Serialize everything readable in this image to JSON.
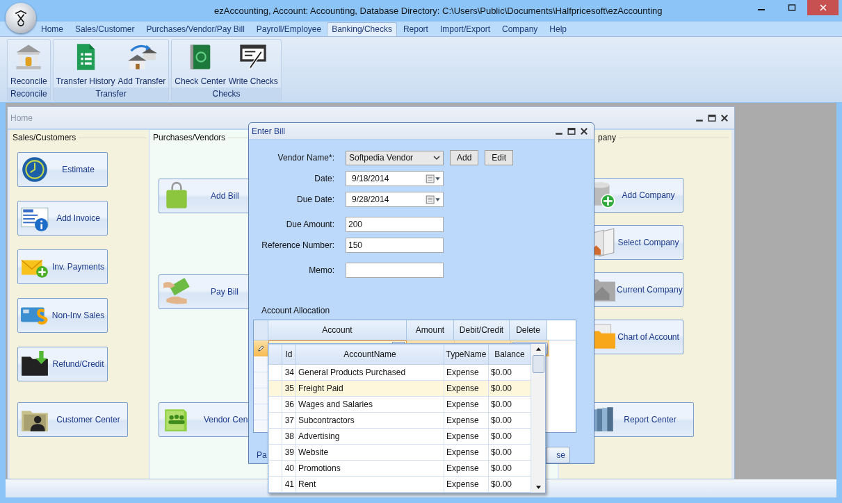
{
  "window": {
    "title": "ezAccounting, Account: Accounting, Database Directory: C:\\Users\\Public\\Documents\\Halfpricesoft\\ezAccounting"
  },
  "menu_tabs": [
    {
      "label": "Home",
      "selected": false
    },
    {
      "label": "Sales/Customer",
      "selected": false
    },
    {
      "label": "Purchases/Vendor/Pay Bill",
      "selected": false
    },
    {
      "label": "Payroll/Employee",
      "selected": false
    },
    {
      "label": "Banking/Checks",
      "selected": true
    },
    {
      "label": "Report",
      "selected": false
    },
    {
      "label": "Import/Export",
      "selected": false
    },
    {
      "label": "Company",
      "selected": false
    },
    {
      "label": "Help",
      "selected": false
    }
  ],
  "ribbon_groups": [
    {
      "label": "Reconcile",
      "buttons": [
        {
          "label": "Reconcile"
        }
      ]
    },
    {
      "label": "Transfer",
      "buttons": [
        {
          "label": "Transfer History"
        },
        {
          "label": "Add Transfer"
        }
      ]
    },
    {
      "label": "Checks",
      "buttons": [
        {
          "label": "Check Center"
        },
        {
          "label": "Write Checks"
        }
      ]
    }
  ],
  "home_window": {
    "title": "Home",
    "sections": [
      {
        "title": "Sales/Customers",
        "buttons": [
          {
            "label": "Estimate"
          },
          {
            "label": "Add Invoice"
          },
          {
            "label": "Inv. Payments"
          },
          {
            "label": "Non-Inv Sales"
          },
          {
            "label": "Refund/Credit"
          },
          {
            "label": "Customer Center"
          }
        ]
      },
      {
        "title": "Purchases/Vendors",
        "buttons": [
          {
            "label": "Add Bill"
          },
          {
            "label": "Pay Bill"
          },
          {
            "label": "Vendor Cen"
          }
        ]
      },
      {
        "title": "pany",
        "buttons": [
          {
            "label": "Add Company"
          },
          {
            "label": "Select Company"
          },
          {
            "label": "Current Company"
          },
          {
            "label": "Chart of Account"
          },
          {
            "label": "Report Center"
          }
        ]
      }
    ]
  },
  "enter_bill": {
    "title": "Enter Bill",
    "fields": [
      {
        "label": "Vendor Name*:",
        "kind": "combo",
        "value": "Softpedia Vendor"
      },
      {
        "label": "Date:",
        "kind": "date",
        "value": "9/18/2014"
      },
      {
        "label": "Due Date:",
        "kind": "date",
        "value": "9/28/2014"
      },
      {
        "label": "Due Amount:",
        "kind": "text",
        "value": "200"
      },
      {
        "label": "Reference Number:",
        "kind": "text",
        "value": "150"
      },
      {
        "label": "Memo:",
        "kind": "text"
      }
    ],
    "vendor_buttons": [
      "Add",
      "Edit"
    ],
    "allocation_title": "Account Allocation",
    "allocation_columns": [
      "Account",
      "Amount",
      "Debit/Credit",
      "Delete"
    ],
    "footer_buttons": [
      "Pa",
      "se"
    ]
  },
  "account_dropdown": {
    "columns": [
      "Id",
      "AccountName",
      "TypeName",
      "Balance"
    ],
    "rows": [
      {
        "id": "34",
        "name": "General Products Purchased",
        "type": "Expense",
        "balance": "$0.00",
        "selected": false
      },
      {
        "id": "35",
        "name": "Freight Paid",
        "type": "Expense",
        "balance": "$0.00",
        "selected": true
      },
      {
        "id": "36",
        "name": "Wages and Salaries",
        "type": "Expense",
        "balance": "$0.00",
        "selected": false
      },
      {
        "id": "37",
        "name": "Subcontractors",
        "type": "Expense",
        "balance": "$0.00",
        "selected": false
      },
      {
        "id": "38",
        "name": "Advertising",
        "type": "Expense",
        "balance": "$0.00",
        "selected": false
      },
      {
        "id": "39",
        "name": "Website",
        "type": "Expense",
        "balance": "$0.00",
        "selected": false
      },
      {
        "id": "40",
        "name": "Promotions",
        "type": "Expense",
        "balance": "$0.00",
        "selected": false
      },
      {
        "id": "41",
        "name": "Rent",
        "type": "Expense",
        "balance": "$0.00",
        "selected": false
      }
    ]
  }
}
